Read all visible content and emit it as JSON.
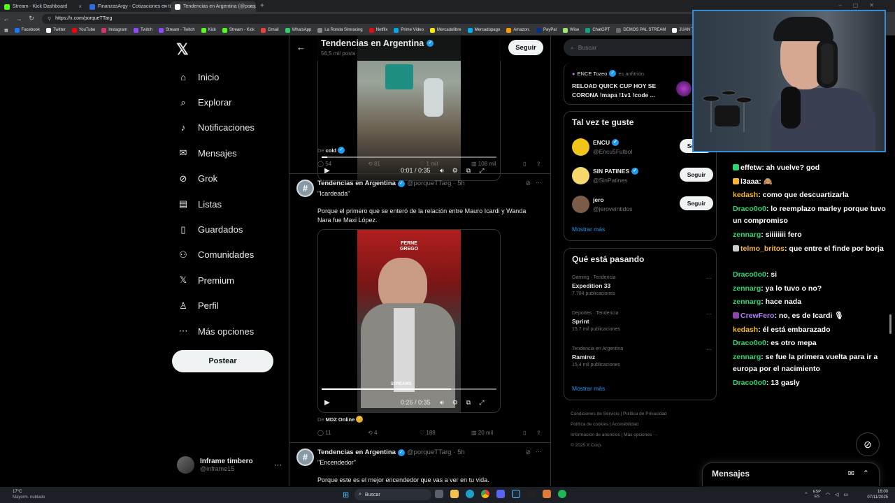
{
  "browser": {
    "tabs": [
      {
        "title": "Stream - Kick Dashboard",
        "color": "#53fc18",
        "active": false
      },
      {
        "title": "FinanzasArgy - Cotizaciones en ti...",
        "color": "#2d6cdf",
        "active": false
      },
      {
        "title": "Tendencias en Argentina (@porqu...",
        "color": "#ffffff",
        "active": true
      }
    ],
    "url": "https://x.com/porqueTTarg",
    "bookmarks": [
      {
        "label": "Facebook",
        "color": "#1877f2"
      },
      {
        "label": "Twitter",
        "color": "#ffffff"
      },
      {
        "label": "YouTube",
        "color": "#ff0000"
      },
      {
        "label": "Instagram",
        "color": "#e1306c"
      },
      {
        "label": "Twitch",
        "color": "#9146ff"
      },
      {
        "label": "Stream - Twitch",
        "color": "#9146ff"
      },
      {
        "label": "Kick",
        "color": "#53fc18"
      },
      {
        "label": "Stream - Kick",
        "color": "#53fc18"
      },
      {
        "label": "Gmail",
        "color": "#ea4335"
      },
      {
        "label": "WhatsApp",
        "color": "#25d366"
      },
      {
        "label": "La Ronda Simracing",
        "color": "#888888"
      },
      {
        "label": "Netflix",
        "color": "#e50914"
      },
      {
        "label": "Prime Video",
        "color": "#00a8e1"
      },
      {
        "label": "Mercadolibre",
        "color": "#ffe600"
      },
      {
        "label": "Mercadopago",
        "color": "#00b1ea"
      },
      {
        "label": "Amazon.",
        "color": "#ff9900"
      },
      {
        "label": "PayPal",
        "color": "#003087"
      },
      {
        "label": "Wise",
        "color": "#9fe870"
      },
      {
        "label": "ChatGPT",
        "color": "#10a37f"
      },
      {
        "label": "DEMOS PAL STREAM",
        "color": "#6b6b6b"
      },
      {
        "label": "JUAN TUR...",
        "color": "#ffffff"
      }
    ]
  },
  "sidebar": {
    "items": [
      {
        "label": "Inicio",
        "icon": "home-icon",
        "glyph": "⌂"
      },
      {
        "label": "Explorar",
        "icon": "search-icon",
        "glyph": "⌕"
      },
      {
        "label": "Notificaciones",
        "icon": "bell-icon",
        "glyph": "♪"
      },
      {
        "label": "Mensajes",
        "icon": "mail-icon",
        "glyph": "✉"
      },
      {
        "label": "Grok",
        "icon": "grok-icon",
        "glyph": "⊘"
      },
      {
        "label": "Listas",
        "icon": "list-icon",
        "glyph": "▤"
      },
      {
        "label": "Guardados",
        "icon": "bookmark-icon",
        "glyph": "▯"
      },
      {
        "label": "Comunidades",
        "icon": "communities-icon",
        "glyph": "⚇"
      },
      {
        "label": "Premium",
        "icon": "x-icon",
        "glyph": "𝕏"
      },
      {
        "label": "Perfil",
        "icon": "person-icon",
        "glyph": "♙"
      },
      {
        "label": "Más opciones",
        "icon": "more-icon",
        "glyph": "⋯"
      }
    ],
    "post_label": "Postear",
    "profile": {
      "name": "Inframe timbero",
      "handle": "@inframe15"
    }
  },
  "header": {
    "title": "Tendencias en Argentina",
    "subtitle": "56,5 mil posts",
    "follow_label": "Seguir"
  },
  "tweets": [
    {
      "video": {
        "time": "0:01 / 0:35",
        "progress": 0.03
      },
      "from_prefix": "De",
      "from": "cold",
      "stats": {
        "replies": "54",
        "retweets": "81",
        "likes": "1 mil",
        "views": "108 mil"
      }
    },
    {
      "author": "Tendencias en Argentina",
      "handle": "@porqueTTarg",
      "time": "· 5h",
      "title": "\"Icardeada\"",
      "body": "Porque el primero que se enteró de la relación entre Mauro Icardi y Wanda Nara fue Maxi López.",
      "video": {
        "time": "0:26 / 0:35",
        "progress": 0.74,
        "overlay": "FERNE GREGO",
        "watermark": "STREAMS"
      },
      "from_prefix": "De",
      "from": "MDZ Online",
      "stats": {
        "replies": "11",
        "retweets": "4",
        "likes": "188",
        "views": "20 mil"
      }
    },
    {
      "author": "Tendencias en Argentina",
      "handle": "@porqueTTarg",
      "time": "· 5h",
      "title": "\"Encendedor\"",
      "body": "Porque este es el mejor encendedor que vas a ver en tu vida."
    }
  ],
  "right": {
    "search_placeholder": "Buscar",
    "space": {
      "host": "ENCE Tozeo",
      "host_suffix": "es anfitrión",
      "title": "RELOAD QUICK CUP HOY SE CORONA !mapa !1v1 !code ..."
    },
    "suggestions_title": "Tal vez te guste",
    "suggestions": [
      {
        "name": "ENCU",
        "handle": "@Encu5Futbol",
        "button": "Seguir",
        "color": "#f0c419"
      },
      {
        "name": "SIN PATINES",
        "handle": "@SinPatines",
        "button": "Seguir",
        "color": "#f5d76e"
      },
      {
        "name": "jero",
        "handle": "@jeroveintidos",
        "button": "Seguir",
        "color": "#7a5c48"
      }
    ],
    "show_more": "Mostrar más",
    "trends_title": "Qué está pasando",
    "trends": [
      {
        "category": "Gaming · Tendencia",
        "name": "Expedition 33",
        "count": "7.784 publicaciones"
      },
      {
        "category": "Deportes · Tendencia",
        "name": "Sprint",
        "count": "15,7 mil publicaciones"
      },
      {
        "category": "Tendencia en Argentina",
        "name": "Ramirez",
        "count": "15,4 mil publicaciones"
      }
    ],
    "trends_more": "Mostrar más",
    "footer": [
      "Condiciones de Servicio",
      "Política de Privacidad",
      "Política de cookies",
      "Accesibilidad",
      "Información de anuncios",
      "Más opciones ···",
      "© 2025 X Corp."
    ]
  },
  "chat": [
    {
      "user": "effetw",
      "color": "#ffffff",
      "badge": "#2ed573",
      "text": ": ah vuelve? god"
    },
    {
      "user": "l3aaa",
      "color": "#ffffff",
      "badge": "#f7b731",
      "text": ": 🙈"
    },
    {
      "user": "kedash",
      "color": "#f7b731",
      "badge": "",
      "text": ": como que descuartizarla"
    },
    {
      "user": "Draco0o0",
      "color": "#2ed573",
      "badge": "",
      "text": ": lo reemplazo marley porque tuvo un compromiso"
    },
    {
      "user": "zennarg",
      "color": "#2ed573",
      "badge": "",
      "text": ": siiiiiiii fero"
    },
    {
      "user": "telmo_britos",
      "color": "#f7b731",
      "badge": "#cccccc",
      "text": ": que entre el finde por borja"
    },
    {
      "user": "Draco0o0",
      "color": "#2ed573",
      "badge": "",
      "text": ": si"
    },
    {
      "user": "zennarg",
      "color": "#2ed573",
      "badge": "",
      "text": ": ya lo tuvo o no?"
    },
    {
      "user": "zennarg",
      "color": "#2ed573",
      "badge": "",
      "text": ": hace nada"
    },
    {
      "user": "CrewFero",
      "color": "#b57cff",
      "badge": "#8e44ad",
      "text": ": no, es de Icardi 🎙"
    },
    {
      "user": "kedash",
      "color": "#f7b731",
      "badge": "",
      "text": ": él está embarazado"
    },
    {
      "user": "Draco0o0",
      "color": "#2ed573",
      "badge": "",
      "text": ": es otro mepa"
    },
    {
      "user": "zennarg",
      "color": "#2ed573",
      "badge": "",
      "text": ": se fue la primera vuelta para ir a europa por el nacimiento"
    },
    {
      "user": "Draco0o0",
      "color": "#2ed573",
      "badge": "",
      "text": ": 13 gasly"
    }
  ],
  "messages_drawer": {
    "title": "Mensajes"
  },
  "taskbar": {
    "weather_temp": "17°C",
    "weather_desc": "Mayorm. nublado",
    "search": "Buscar",
    "lang_top": "ESP",
    "lang_bottom": "ES",
    "time": "16:00",
    "date": "07/11/2025"
  }
}
